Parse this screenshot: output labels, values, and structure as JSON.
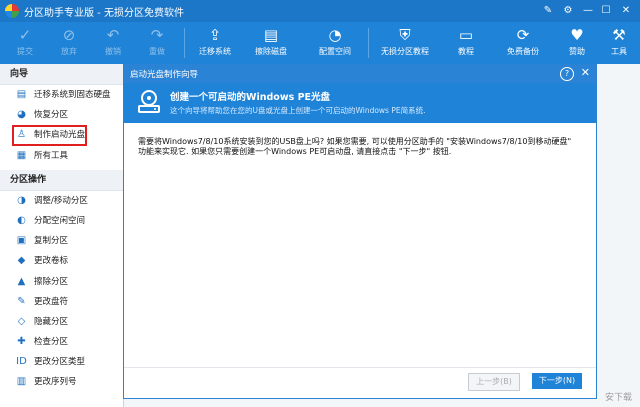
{
  "window": {
    "title": "分区助手专业版 - 无损分区免费软件"
  },
  "toolbar": {
    "buttons": [
      {
        "label": "提交",
        "icon": "check"
      },
      {
        "label": "放弃",
        "icon": "forbid"
      },
      {
        "label": "撤销",
        "icon": "undo"
      },
      {
        "label": "重做",
        "icon": "redo"
      },
      {
        "label": "迁移系统",
        "icon": "migrate"
      },
      {
        "label": "擦除磁盘",
        "icon": "erase"
      },
      {
        "label": "配置空间",
        "icon": "pie"
      },
      {
        "label": "无损分区教程",
        "icon": "shield"
      },
      {
        "label": "教程",
        "icon": "book"
      },
      {
        "label": "免费备份",
        "icon": "backup"
      },
      {
        "label": "赞助",
        "icon": "heart"
      },
      {
        "label": "工具",
        "icon": "wrench"
      }
    ]
  },
  "sidebar": {
    "wizard_header": "向导",
    "wizard_items": [
      {
        "label": "迁移系统到固态硬盘"
      },
      {
        "label": "恢复分区"
      },
      {
        "label": "制作启动光盘"
      },
      {
        "label": "所有工具"
      }
    ],
    "ops_header": "分区操作",
    "ops_items": [
      {
        "label": "调整/移动分区"
      },
      {
        "label": "分配空闲空间"
      },
      {
        "label": "复制分区"
      },
      {
        "label": "更改卷标"
      },
      {
        "label": "擦除分区"
      },
      {
        "label": "更改盘符"
      },
      {
        "label": "隐藏分区"
      },
      {
        "label": "检查分区"
      },
      {
        "label": "更改分区类型"
      },
      {
        "label": "更改序列号"
      }
    ]
  },
  "dialog": {
    "title": "启动光盘制作向导",
    "banner_title": "创建一个可启动的Windows PE光盘",
    "banner_subtitle": "这个向导将帮助您在您的U盘或光盘上创建一个可启动的Windows PE简系统.",
    "body_line1": "需要将Windows7/8/10系统安装到您的USB盘上吗? 如果您需要, 可以使用分区助手的 \"安装Windows7/8/10到移动硬盘\"",
    "body_line2": "功能来实现它. 如果您只需要创建一个Windows PE可启动盘, 请直接点击 \"下一步\" 按钮.",
    "prev_label": "上一步(B)",
    "next_label": "下一步(N)"
  },
  "watermark": "安下载"
}
